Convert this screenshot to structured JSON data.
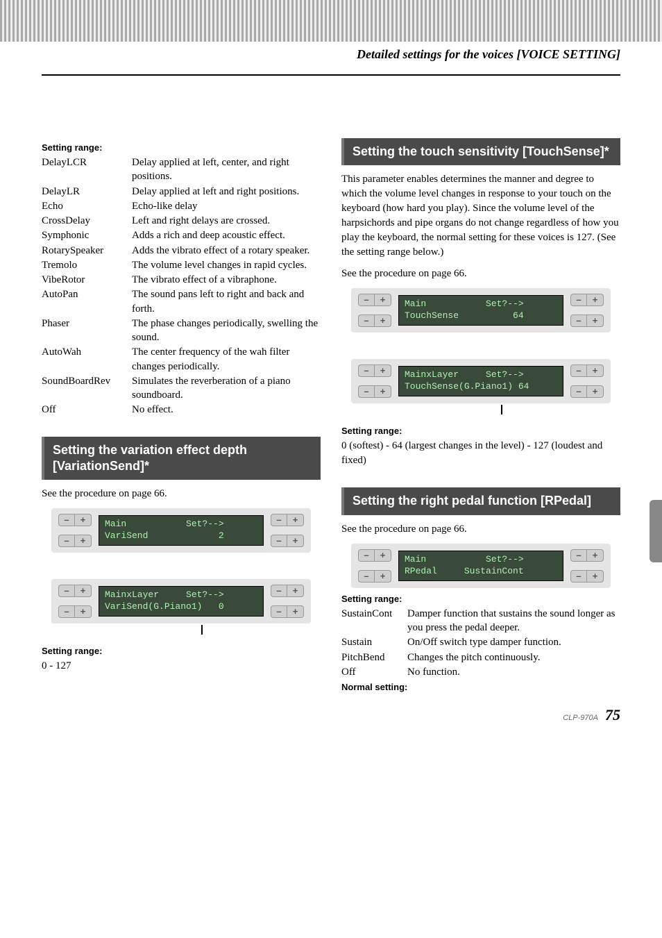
{
  "header": {
    "title": "Detailed settings for the voices [VOICE SETTING]"
  },
  "left": {
    "setting_range_label": "Setting range:",
    "effects": [
      {
        "term": "DelayLCR",
        "desc": "Delay applied at left, center, and right positions."
      },
      {
        "term": "DelayLR",
        "desc": "Delay applied at left and right positions."
      },
      {
        "term": "Echo",
        "desc": "Echo-like delay"
      },
      {
        "term": "CrossDelay",
        "desc": "Left and right delays are crossed."
      },
      {
        "term": "Symphonic",
        "desc": "Adds a rich and deep acoustic effect."
      },
      {
        "term": "RotarySpeaker",
        "desc": "Adds the vibrato effect of a rotary speaker."
      },
      {
        "term": "Tremolo",
        "desc": "The volume level changes in rapid cycles."
      },
      {
        "term": "VibeRotor",
        "desc": "The vibrato effect of a vibraphone."
      },
      {
        "term": "AutoPan",
        "desc": "The sound pans left to right and back and forth."
      },
      {
        "term": "Phaser",
        "desc": "The phase changes periodically, swelling the sound."
      },
      {
        "term": "AutoWah",
        "desc": "The center frequency of the wah filter changes periodically."
      },
      {
        "term": "SoundBoardRev",
        "desc": "Simulates the reverberation of a piano soundboard."
      },
      {
        "term": "Off",
        "desc": "No effect."
      }
    ],
    "section2_title": "Setting the variation effect depth [VariationSend]*",
    "see_procedure": "See the procedure on page 66.",
    "lcd1_line1": "Main           Set?-->",
    "lcd1_line2": "VariSend             2",
    "lcd2_line1": "MainxLayer     Set?-->",
    "lcd2_line2": "VariSend(G.Piano1)   0",
    "setting_range_label2": "Setting range:",
    "range2": "0 - 127"
  },
  "right": {
    "section1_title": "Setting the touch sensitivity [TouchSense]*",
    "body1": "This parameter enables determines the manner and degree to which the volume level changes in response to your touch on the keyboard (how hard you play). Since the volume level of the harpsichords and pipe organs do not change regardless of how you play the keyboard, the normal setting for these voices is 127. (See the setting range below.)",
    "see_procedure1": "See the procedure on page 66.",
    "lcd1_line1": "Main           Set?-->",
    "lcd1_line2": "TouchSense          64",
    "lcd2_line1": "MainxLayer     Set?-->",
    "lcd2_line2": "TouchSense(G.Piano1) 64",
    "setting_range_label": "Setting range:",
    "range1": "0 (softest) - 64 (largest changes in the level) - 127 (loudest and fixed)",
    "section2_title": "Setting the right pedal function [RPedal]",
    "see_procedure2": "See the procedure on page 66.",
    "lcd3_line1": "Main           Set?-->",
    "lcd3_line2": "RPedal     SustainCont",
    "setting_range_label2": "Setting range:",
    "pedals": [
      {
        "term": "SustainCont",
        "desc": "Damper function that sustains the sound longer as you press the pedal deeper."
      },
      {
        "term": "Sustain",
        "desc": "On/Off switch type damper function."
      },
      {
        "term": "PitchBend",
        "desc": "Changes the pitch continuously."
      },
      {
        "term": "Off",
        "desc": "No function."
      }
    ],
    "normal_setting_label": "Normal setting:"
  },
  "footer": {
    "model": "CLP-970A",
    "page": "75"
  },
  "buttons": {
    "minus": "–",
    "plus": "+"
  }
}
